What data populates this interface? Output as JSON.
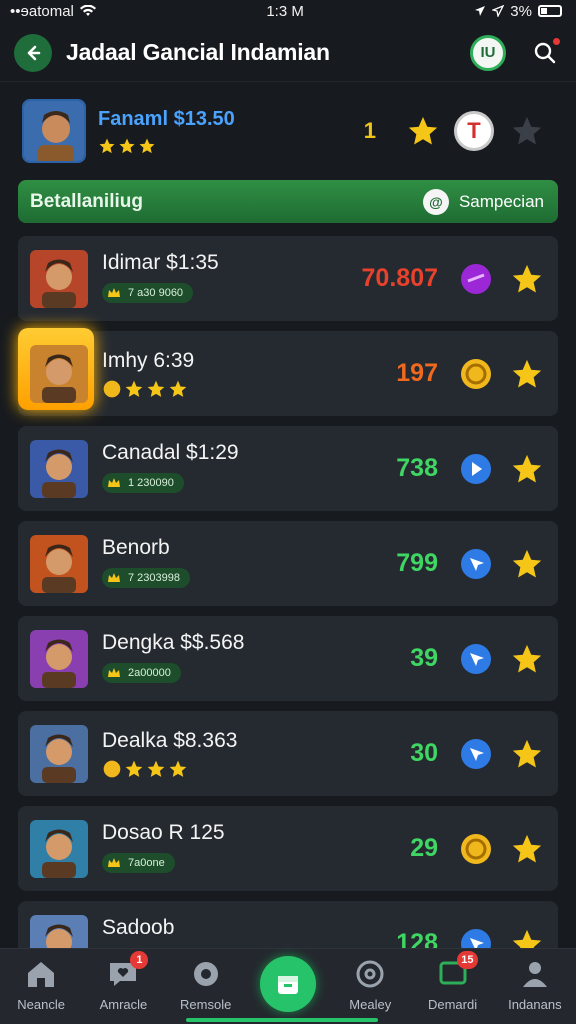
{
  "status_bar": {
    "carrier": "••ɘatomal",
    "time": "1:3 M",
    "battery": "3%"
  },
  "header": {
    "title": "Jadaal Gancial Indamian",
    "avatar_initials": "IU"
  },
  "profile": {
    "name": "Fanaml $13.50",
    "count": "1",
    "badge_letter": "T",
    "stars": 3
  },
  "banner": {
    "title": "Betallaniliug",
    "action_label": "Sampecian",
    "action_icon_text": "@"
  },
  "rows": [
    {
      "name": "Idimar $1:35",
      "chip": "7 a30 9060",
      "value": "70.807",
      "value_color": "#e8412c",
      "badge": "purple-orb",
      "chip_style": "chip",
      "stars": 0
    },
    {
      "name": "Imhy 6:39",
      "chip": "",
      "value": "197",
      "value_color": "#ef6a1f",
      "badge": "gold-coin",
      "chip_style": "stars",
      "stars": 3,
      "highlight": true
    },
    {
      "name": "Canadal $1:29",
      "chip": "1 230090",
      "value": "738",
      "value_color": "#3fd663",
      "badge": "blue-play",
      "chip_style": "chip",
      "stars": 0
    },
    {
      "name": "Benorb",
      "chip": "7 2303998",
      "value": "799",
      "value_color": "#3fd663",
      "badge": "blue-arrow",
      "chip_style": "chip",
      "stars": 0
    },
    {
      "name": "Dengka $$.568",
      "chip": "2a00000",
      "value": "39",
      "value_color": "#3fd663",
      "badge": "blue-arrow",
      "chip_style": "chip",
      "stars": 0
    },
    {
      "name": "Dealka $8.363",
      "chip": "",
      "value": "30",
      "value_color": "#3fd663",
      "badge": "blue-arrow",
      "chip_style": "stars",
      "stars": 3
    },
    {
      "name": "Dosao R 125",
      "chip": "7a0one",
      "value": "29",
      "value_color": "#3fd663",
      "badge": "gold-coin",
      "chip_style": "chip",
      "stars": 0
    },
    {
      "name": "Sadoob",
      "chip": "",
      "value": "128",
      "value_color": "#3fd663",
      "badge": "blue-arrow",
      "chip_style": "chip",
      "stars": 0
    }
  ],
  "nav": [
    {
      "label": "Neancle",
      "icon": "home-icon",
      "count": ""
    },
    {
      "label": "Amracle",
      "icon": "heart-chat-icon",
      "count": "1"
    },
    {
      "label": "Remsole",
      "icon": "gear-icon",
      "count": ""
    },
    {
      "label": "",
      "icon": "inbox-icon",
      "count": ""
    },
    {
      "label": "Mealey",
      "icon": "at-icon",
      "count": ""
    },
    {
      "label": "Demardi",
      "icon": "chat-icon",
      "count": "15"
    },
    {
      "label": "Indanans",
      "icon": "person-icon",
      "count": ""
    }
  ],
  "colors": {
    "accent": "#27c36a",
    "star": "#f5c518",
    "card": "#252a31",
    "background": "#171a1e"
  }
}
